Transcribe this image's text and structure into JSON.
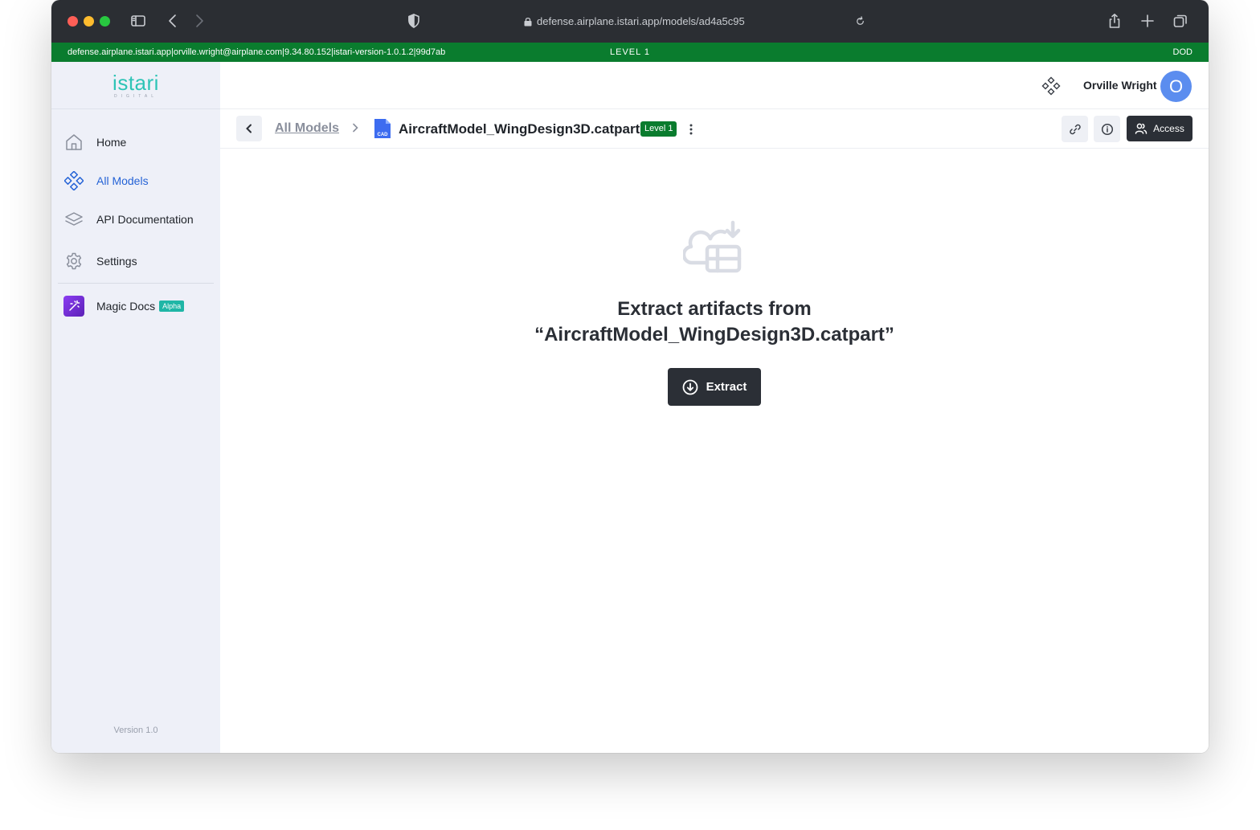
{
  "browser": {
    "url": "defense.airplane.istari.app/models/ad4a5c95"
  },
  "banner": {
    "left": "defense.airplane.istari.app|orville.wright@airplane.com|9.34.80.152|istari-version-1.0.1.2|99d7ab",
    "center": "LEVEL 1",
    "right": "DOD",
    "color": "#0a7c2e"
  },
  "sidebar": {
    "logo": {
      "word": "istari",
      "sub": "DIGITAL"
    },
    "items": [
      {
        "label": "Home",
        "icon": "home-icon"
      },
      {
        "label": "All Models",
        "icon": "models-icon",
        "active": true
      },
      {
        "label": "API Documentation",
        "icon": "layers-icon"
      },
      {
        "label": "Settings",
        "icon": "gear-icon"
      },
      {
        "label": "Magic Docs",
        "icon": "magic-wand-icon",
        "badge": "Alpha"
      }
    ],
    "version": "Version 1.0",
    "accent": "#2563d6"
  },
  "header": {
    "user_name": "Orville Wright",
    "avatar_initial": "O"
  },
  "breadcrumb": {
    "parent": "All Models",
    "file_type": "CAD",
    "title": "AircraftModel_WingDesign3D.catpart",
    "level": "Level 1",
    "access_label": "Access"
  },
  "empty_state": {
    "line1": "Extract artifacts from",
    "line2": "“AircraftModel_WingDesign3D.catpart”",
    "button_label": "Extract"
  }
}
